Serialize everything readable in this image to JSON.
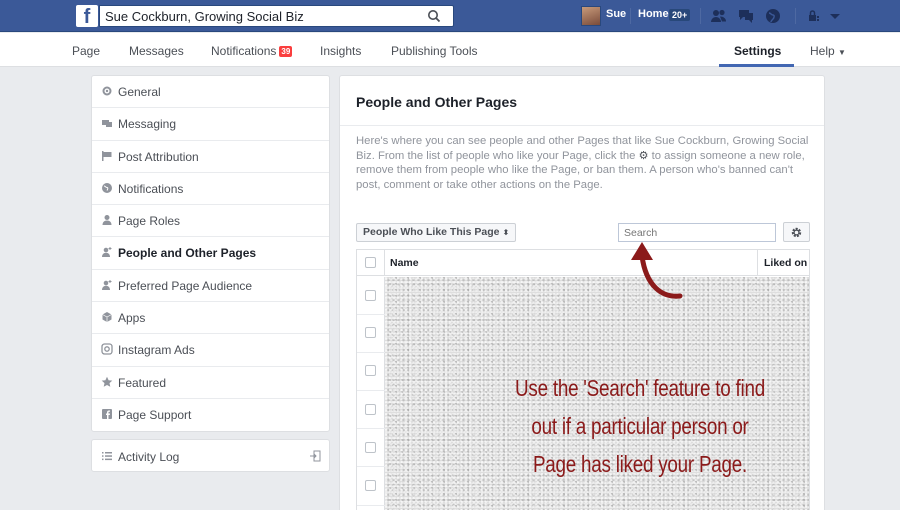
{
  "topbar": {
    "search_value": "Sue Cockburn, Growing Social Biz",
    "user_name": "Sue",
    "home_label": "Home",
    "home_badge": "20+"
  },
  "page_nav": {
    "tabs": [
      {
        "label": "Page"
      },
      {
        "label": "Messages"
      },
      {
        "label": "Notifications",
        "badge": "39"
      },
      {
        "label": "Insights"
      },
      {
        "label": "Publishing Tools"
      }
    ],
    "settings_label": "Settings",
    "help_label": "Help"
  },
  "sidebar": {
    "items": [
      {
        "label": "General",
        "icon": "gear-icon"
      },
      {
        "label": "Messaging",
        "icon": "messaging-icon"
      },
      {
        "label": "Post Attribution",
        "icon": "flag-icon"
      },
      {
        "label": "Notifications",
        "icon": "globe-icon"
      },
      {
        "label": "Page Roles",
        "icon": "person-icon"
      },
      {
        "label": "People and Other Pages",
        "icon": "person-plus-icon",
        "active": true
      },
      {
        "label": "Preferred Page Audience",
        "icon": "person-plus-icon"
      },
      {
        "label": "Apps",
        "icon": "cube-icon"
      },
      {
        "label": "Instagram Ads",
        "icon": "instagram-icon"
      },
      {
        "label": "Featured",
        "icon": "star-icon"
      },
      {
        "label": "Page Support",
        "icon": "facebook-page-icon"
      }
    ],
    "activity_log_label": "Activity Log"
  },
  "main": {
    "title": "People and Other Pages",
    "description_part1": "Here's where you can see people and other Pages that like Sue Cockburn, Growing Social Biz. From the list of people who like your Page, click the",
    "description_part2": "to assign someone a new role, remove them from people who like the Page, or ban them. A person who's banned can't post, comment or take other actions on the Page.",
    "filter_label": "People Who Like This Page",
    "search_placeholder": "Search",
    "table": {
      "col_name": "Name",
      "col_liked": "Liked on"
    },
    "annotation_lines": [
      "Use the 'Search' feature to find",
      "out if a particular person or",
      "Page has liked your Page."
    ]
  },
  "colors": {
    "brand_blue": "#3b5998",
    "accent_blue": "#4267b2",
    "annotation_red": "#8b1a1a",
    "badge_red": "#fa3e3e"
  }
}
